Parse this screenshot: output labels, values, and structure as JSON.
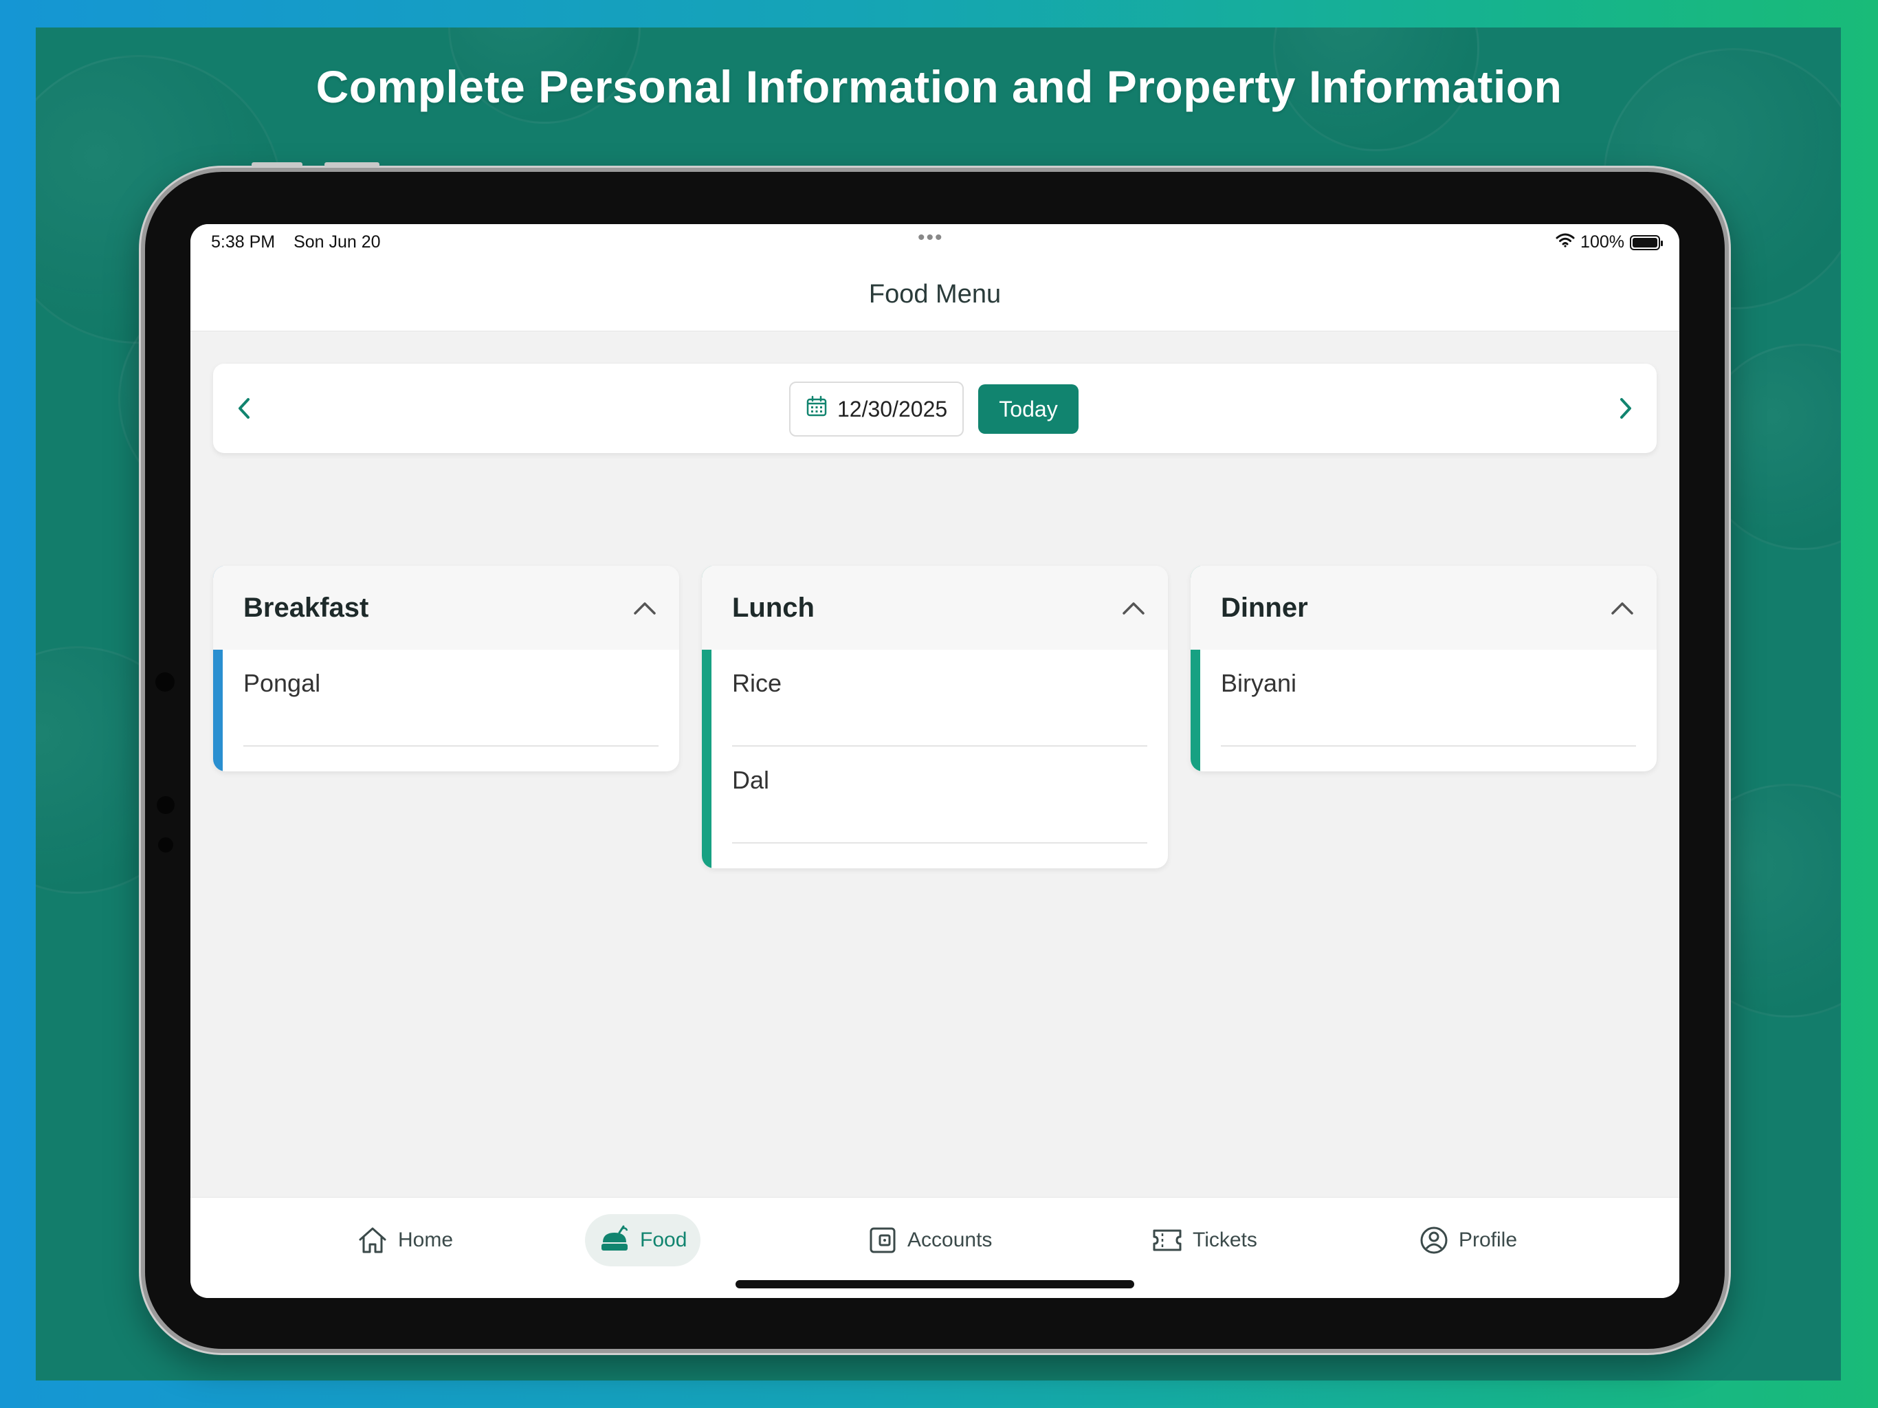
{
  "banner": {
    "title": "Complete Personal Information and Property Information"
  },
  "status_bar": {
    "time": "5:38 PM",
    "date": "Son Jun 20",
    "dots": "•••",
    "battery": "100%"
  },
  "header": {
    "title": "Food Menu"
  },
  "date_picker": {
    "value": "12/30/2025",
    "today_label": "Today"
  },
  "meals": [
    {
      "title": "Breakfast",
      "accent": "#2a8fd0",
      "items": [
        "Pongal"
      ]
    },
    {
      "title": "Lunch",
      "accent": "#17a182",
      "items": [
        "Rice",
        "Dal"
      ]
    },
    {
      "title": "Dinner",
      "accent": "#17a182",
      "items": [
        "Biryani"
      ]
    }
  ],
  "tab_bar": {
    "tabs": [
      {
        "label": "Home",
        "icon": "home-icon"
      },
      {
        "label": "Food",
        "icon": "food-icon",
        "active": true
      },
      {
        "label": "Accounts",
        "icon": "accounts-icon"
      },
      {
        "label": "Tickets",
        "icon": "tickets-icon"
      },
      {
        "label": "Profile",
        "icon": "profile-icon"
      }
    ]
  },
  "colors": {
    "primary": "#11846f",
    "banner_bg": "#137d6b",
    "breakfast_accent": "#2a8fd0",
    "meal_accent": "#17a182"
  }
}
